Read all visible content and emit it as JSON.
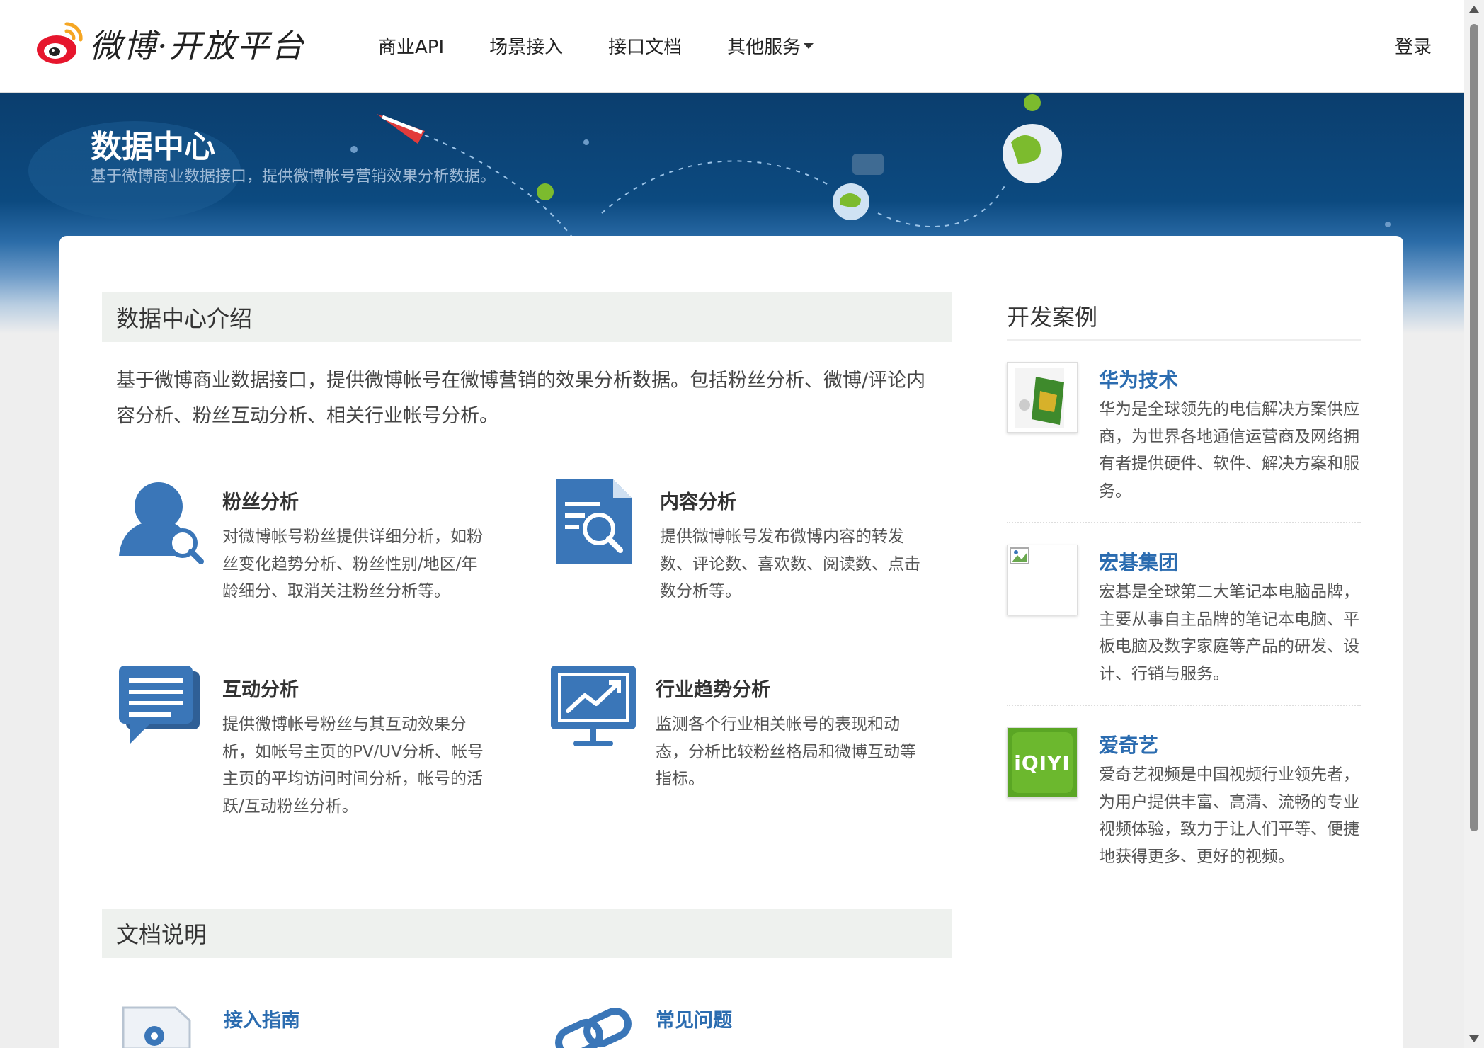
{
  "header": {
    "logo_text": "微博·开放平台",
    "nav": [
      {
        "label": "商业API"
      },
      {
        "label": "场景接入"
      },
      {
        "label": "接口文档"
      },
      {
        "label": "其他服务"
      }
    ],
    "login": "登录"
  },
  "banner": {
    "title": "数据中心",
    "subtitle": "基于微博商业数据接口，提供微博帐号营销效果分析数据。"
  },
  "main": {
    "intro_heading": "数据中心介绍",
    "intro_text": "基于微博商业数据接口，提供微博帐号在微博营销的效果分析数据。包括粉丝分析、微博/评论内容分析、粉丝互动分析、相关行业帐号分析。",
    "features": [
      {
        "title": "粉丝分析",
        "desc": "对微博帐号粉丝提供详细分析，如粉丝变化趋势分析、粉丝性别/地区/年龄细分、取消关注粉丝分析等。",
        "icon": "user-search-icon"
      },
      {
        "title": "内容分析",
        "desc": "提供微博帐号发布微博内容的转发数、评论数、喜欢数、阅读数、点击数分析等。",
        "icon": "document-search-icon"
      },
      {
        "title": "互动分析",
        "desc": "提供微博帐号粉丝与其互动效果分析，如帐号主页的PV/UV分析、帐号主页的平均访问时间分析，帐号的活跃/互动粉丝分析。",
        "icon": "chat-bubble-icon"
      },
      {
        "title": "行业趋势分析",
        "desc": "监测各个行业相关帐号的表现和动态，分析比较粉丝格局和微博互动等指标。",
        "icon": "trend-monitor-icon"
      }
    ],
    "docs_heading": "文档说明",
    "docs": [
      {
        "title": "接入指南",
        "icon": "gear-document-icon"
      },
      {
        "title": "常见问题",
        "icon": "link-icon"
      }
    ]
  },
  "sidebar": {
    "title": "开发案例",
    "cases": [
      {
        "name": "华为技术",
        "desc": "华为是全球领先的电信解决方案供应商，为世界各地通信运营商及网络拥有者提供硬件、软件、解决方案和服务。"
      },
      {
        "name": "宏碁集团",
        "desc": "宏碁是全球第二大笔记本电脑品牌，主要从事自主品牌的笔记本电脑、平板电脑及数字家庭等产品的研发、设计、行销与服务。"
      },
      {
        "name": "爱奇艺",
        "desc": "爱奇艺视频是中国视频行业领先者，为用户提供丰富、高清、流畅的专业视频体验，致力于让人们平等、便捷地获得更多、更好的视频。",
        "logo_text": "iQIYI"
      }
    ]
  },
  "colors": {
    "link": "#2b6cb0",
    "icon_blue": "#3a76b8",
    "banner_dark": "#0b3e6e"
  }
}
